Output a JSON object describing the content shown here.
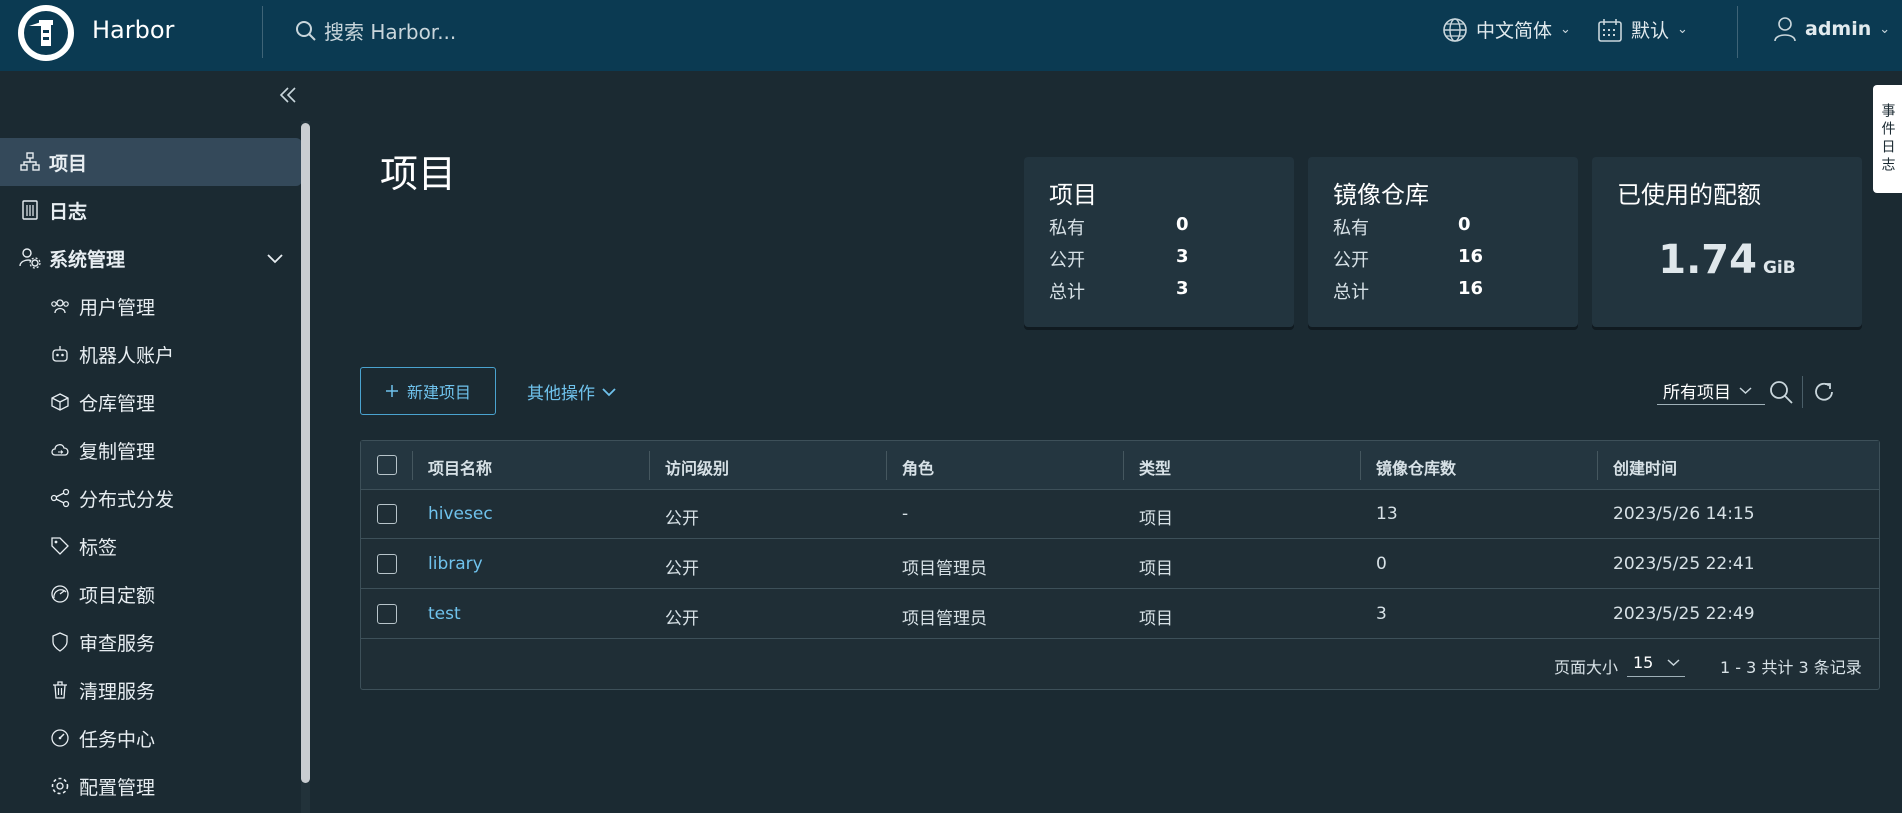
{
  "header": {
    "brand": "Harbor",
    "search_placeholder": "搜索 Harbor...",
    "language": "中文简体",
    "datetime_format": "默认",
    "user": "admin"
  },
  "sidebar": {
    "items": [
      {
        "label": "项目",
        "icon": "projects-icon",
        "active": true
      },
      {
        "label": "日志",
        "icon": "logs-icon"
      },
      {
        "label": "系统管理",
        "icon": "admin-icon",
        "expanded": true
      },
      {
        "label": "用户管理",
        "icon": "users-icon"
      },
      {
        "label": "机器人账户",
        "icon": "robot-icon"
      },
      {
        "label": "仓库管理",
        "icon": "registry-icon"
      },
      {
        "label": "复制管理",
        "icon": "cloud-sync-icon"
      },
      {
        "label": "分布式分发",
        "icon": "share-icon"
      },
      {
        "label": "标签",
        "icon": "tag-icon"
      },
      {
        "label": "项目定额",
        "icon": "quota-icon"
      },
      {
        "label": "审查服务",
        "icon": "shield-icon"
      },
      {
        "label": "清理服务",
        "icon": "trash-icon"
      },
      {
        "label": "任务中心",
        "icon": "dashboard-icon"
      },
      {
        "label": "配置管理",
        "icon": "gear-icon"
      }
    ]
  },
  "main": {
    "title": "项目",
    "cards": {
      "projects": {
        "title": "项目",
        "private_label": "私有",
        "private": "0",
        "public_label": "公开",
        "public": "3",
        "total_label": "总计",
        "total": "3"
      },
      "repos": {
        "title": "镜像仓库",
        "private_label": "私有",
        "private": "0",
        "public_label": "公开",
        "public": "16",
        "total_label": "总计",
        "total": "16"
      },
      "quota": {
        "title": "已使用的配额",
        "value": "1.74",
        "unit": "GiB"
      }
    },
    "toolbar": {
      "new_project": "新建项目",
      "other_actions": "其他操作",
      "filter": "所有项目"
    },
    "table": {
      "headers": [
        "项目名称",
        "访问级别",
        "角色",
        "类型",
        "镜像仓库数",
        "创建时间"
      ],
      "rows": [
        {
          "name": "hivesec",
          "access": "公开",
          "role": "-",
          "type": "项目",
          "repos": "13",
          "created": "2023/5/26 14:15"
        },
        {
          "name": "library",
          "access": "公开",
          "role": "项目管理员",
          "type": "项目",
          "repos": "0",
          "created": "2023/5/25 22:41"
        },
        {
          "name": "test",
          "access": "公开",
          "role": "项目管理员",
          "type": "项目",
          "repos": "3",
          "created": "2023/5/25 22:49"
        }
      ],
      "page_size_label": "页面大小",
      "page_size": "15",
      "count": "1 - 3 共计 3 条记录"
    }
  },
  "right_tab": {
    "label": "事件日志"
  }
}
